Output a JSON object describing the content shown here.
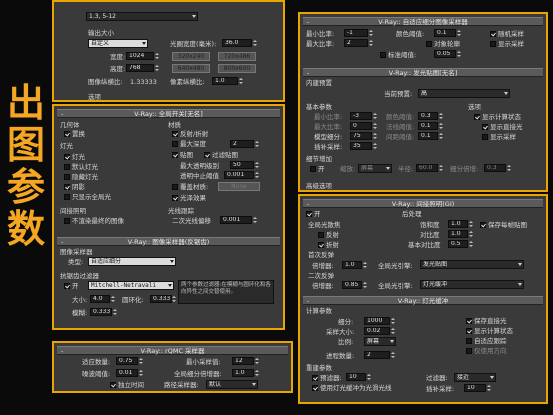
{
  "side_title": [
    "出",
    "图",
    "参",
    "数"
  ],
  "colors": {
    "accent": "#e8a400",
    "title_text": "#f5a623"
  },
  "output_size": {
    "top_dropdown": "1.3, 5-12",
    "section_label": "输出大小",
    "preset": "自定义",
    "aperture_label": "光圈宽度(毫米):",
    "aperture_value": "36.0",
    "width_label": "宽度:",
    "width_value": "1024",
    "height_label": "高度:",
    "height_value": "768",
    "presets": [
      "320x240",
      "720x486",
      "640x480",
      "800x600"
    ],
    "aspect_label": "图像纵横比:",
    "aspect_value": "1.33333",
    "pixel_aspect_label": "像素纵横比:",
    "pixel_aspect_value": "1.0",
    "options_label": "选项"
  },
  "global_switches": {
    "title": "V-Ray:: 全局开关[无名]",
    "geometry_group": "几何体",
    "displacement": "置换",
    "lights_group": "灯光",
    "lights": "灯光",
    "default_lights": "默认灯光",
    "hidden_lights": "隐藏灯光",
    "shadows": "阴影",
    "only_gi": "只显示全局光",
    "indirect_group": "间接照明",
    "no_render_final": "不渲染最终的图像",
    "materials_group": "材质",
    "reflect_refract": "反射/折射",
    "max_depth": "最大深度",
    "max_depth_value": "2",
    "maps": "贴图",
    "filter_maps": "过滤贴图",
    "max_transp_label": "最大透明级别",
    "max_transp_value": "50",
    "transp_cutoff_label": "透明中止阈值",
    "transp_cutoff_value": "0.001",
    "override_mtl": "覆盖材质:",
    "override_btn": "None",
    "glossy": "光泽效果",
    "raytrace_group": "光线跟踪",
    "secondary_bias_label": "二次光线偏移",
    "secondary_bias_value": "0.001"
  },
  "image_sampler": {
    "title": "V-Ray:: 图像采样器(反锯齿)",
    "group": "图像采样器",
    "type_label": "类型:",
    "type_value": "自适应细分",
    "aa_group": "抗锯齿过滤器",
    "on_label": "开",
    "filter_value": "Mitchell-Netravali",
    "desc": "两个参数过滤器:在模糊与圆环化和各向异性之间交替使用。",
    "size_label": "大小:",
    "size_value": "4.0",
    "round_label": "圆环化:",
    "round_value": "0.333",
    "blur_label": "模糊:",
    "blur_value": "0.333"
  },
  "qmc": {
    "title": "V-Ray:: rQMC 采样器",
    "adapt_label": "适应数量:",
    "adapt_value": "0.75",
    "min_samples_label": "最小采样值:",
    "min_samples_value": "12",
    "noise_label": "噪波阈值:",
    "noise_value": "0.01",
    "global_mult_label": "全局细分倍增器:",
    "global_mult_value": "1.0",
    "time_indep": "独立时间",
    "path_sampler_label": "路径采样器:",
    "path_sampler_value": "默认"
  },
  "adaptive_subdiv": {
    "title": "V-Ray:: 自适应细分图像采样器",
    "min_rate_label": "最小比率:",
    "min_rate_value": "-1",
    "max_rate_label": "最大比率:",
    "max_rate_value": "2",
    "clr_thresh_label": "颜色阈值:",
    "clr_thresh_value": "0.1",
    "object_outline": "对象轮廓",
    "normal_thresh_label": "标准阈值:",
    "normal_thresh_value": "0.05",
    "randomize": "随机采样",
    "show_samples": "显示采样"
  },
  "irradiance": {
    "title": "V-Ray:: 发光贴图[无名]",
    "builtin_group": "内建预置",
    "preset_label": "当前预置:",
    "preset_value": "高",
    "basic_group": "基本参数",
    "min_rate_label": "最小比率:",
    "min_rate_value": "-3",
    "max_rate_label": "最大比率:",
    "max_rate_value": "0",
    "model_subdiv_label": "模型细分:",
    "model_subdiv_value": "75",
    "interp_label": "插补采样:",
    "interp_value": "35",
    "clr_thresh_label": "颜色阈值:",
    "clr_thresh_value": "0.3",
    "nrm_thresh_label": "法线阈值:",
    "nrm_thresh_value": "0.1",
    "dist_thresh_label": "间距阈值:",
    "dist_thresh_value": "0.1",
    "options_group": "选项",
    "show_calc": "显示计算状态",
    "show_direct": "显示直接光",
    "show_samples": "显示采样",
    "detail_group": "细节增加",
    "detail_on": "开",
    "scale_label": "缩放:",
    "scale_value": "屏幕",
    "radius_label": "半径:",
    "radius_value": "60.0",
    "subdiv_mult_label": "细分倍增:",
    "subdiv_mult_value": "0.3",
    "advanced": "高级选项"
  },
  "gi": {
    "title": "V-Ray:: 间接照明(GI)",
    "on_label": "开",
    "caustics_group": "全局光散焦",
    "reflective": "反射",
    "refractive": "折射",
    "post_group": "后处理",
    "saturation_label": "饱和度",
    "saturation_value": "1.0",
    "contrast_label": "对比度",
    "contrast_value": "1.0",
    "contrast_base_label": "基本对比度",
    "contrast_base_value": "0.5",
    "save_maps": "保存每帧贴图",
    "primary_group": "首次反弹",
    "primary_mult_label": "倍增器:",
    "primary_mult_value": "1.0",
    "primary_engine_label": "全局光引擎:",
    "primary_engine_value": "发光贴图",
    "secondary_group": "二次反弹",
    "secondary_mult_label": "倍增器:",
    "secondary_mult_value": "0.85",
    "secondary_engine_label": "全局光引擎:",
    "secondary_engine_value": "灯光缓冲"
  },
  "light_cache": {
    "title": "V-Ray:: 灯光缓冲",
    "calc_group": "计算参数",
    "subdivs_label": "细分:",
    "subdivs_value": "1000",
    "sample_size_label": "采样大小:",
    "sample_size_value": "0.02",
    "scale_label": "比例:",
    "scale_value": "屏幕",
    "passes_label": "进程数量:",
    "passes_value": "2",
    "store_direct": "保存直接光",
    "show_calc": "显示计算状态",
    "adaptive_tracing": "自适应跟踪",
    "use_dirs_only": "仅使用方向",
    "recon_group": "重建参数",
    "prefilter_label": "预滤器:",
    "prefilter_value": "10",
    "use_lc": "使用灯光缓冲为光滑光线",
    "filter_label": "过滤器:",
    "filter_value": "接近",
    "interp_label": "插补采样:",
    "interp_value": "10"
  }
}
